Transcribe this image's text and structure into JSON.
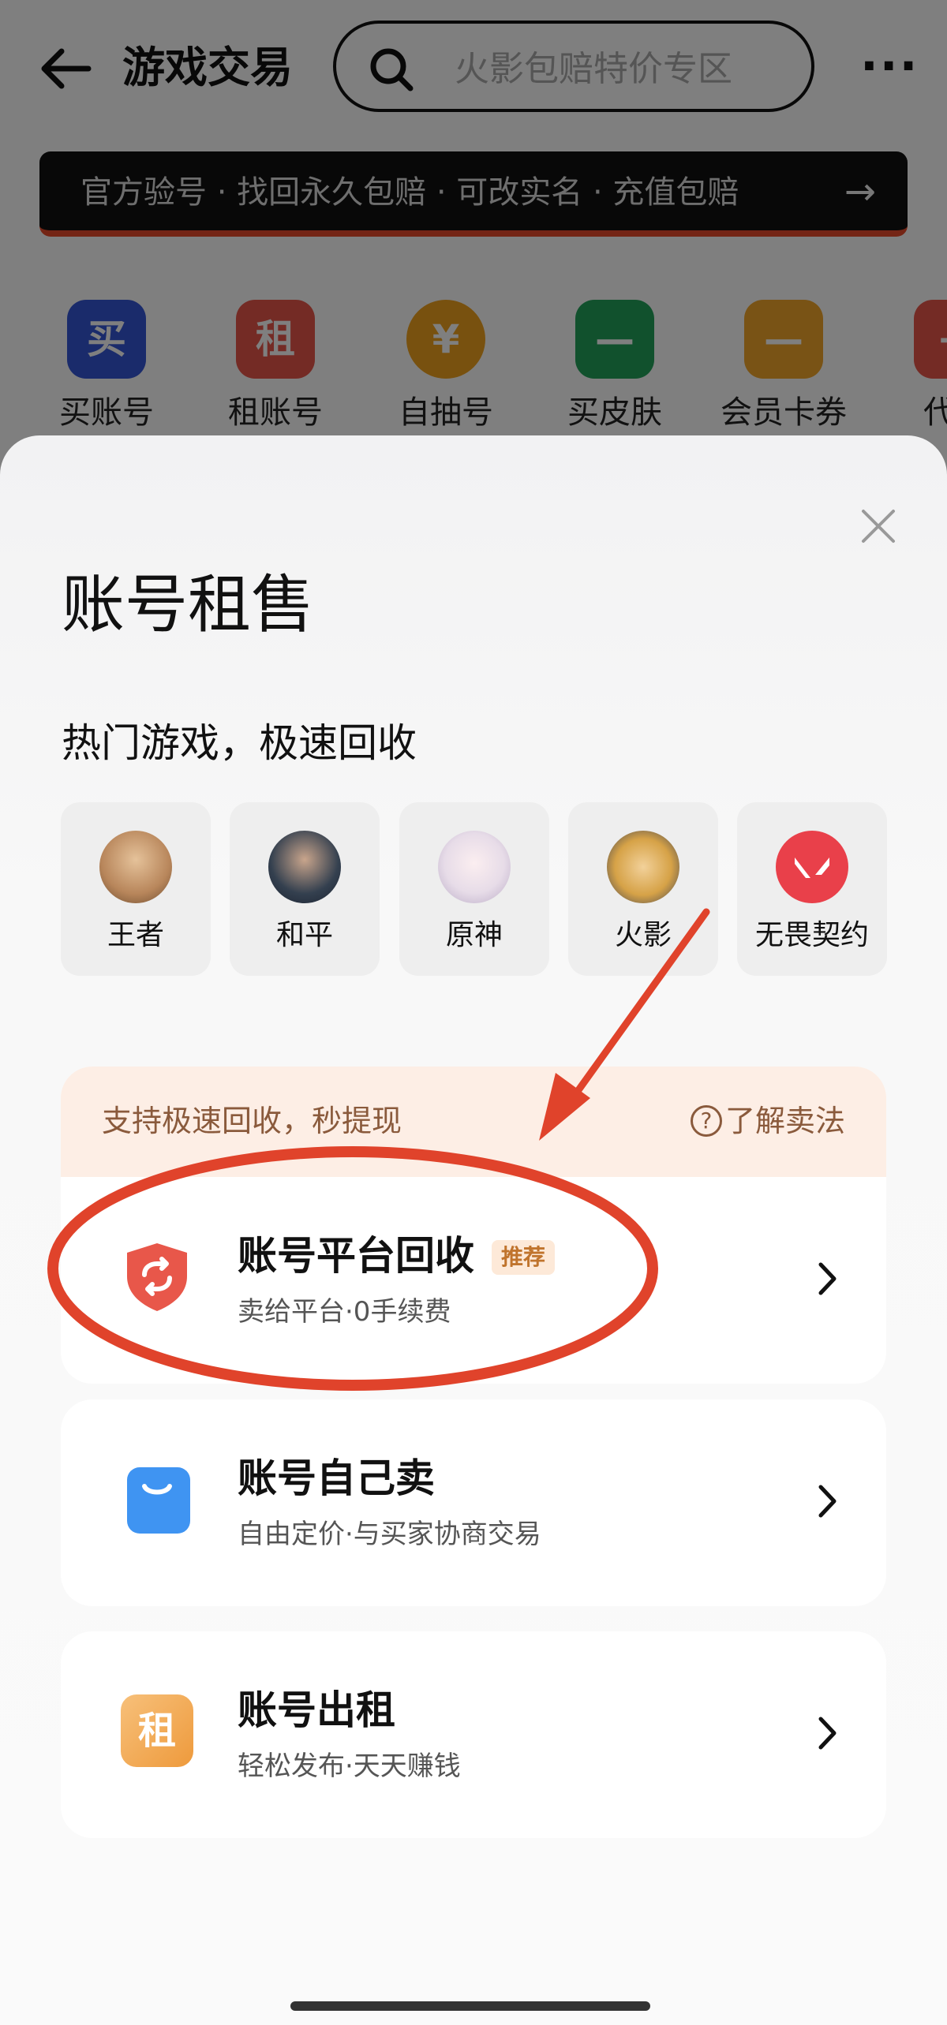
{
  "header": {
    "title": "游戏交易",
    "search_placeholder": "火影包赔特价专区",
    "more_label": "···"
  },
  "banner": {
    "text": "官方验号 · 找回永久包赔 · 可改实名 · 充值包赔",
    "arrow": "→"
  },
  "categories": [
    {
      "label": "买账号",
      "glyph": "买",
      "color": "#3557d6"
    },
    {
      "label": "租账号",
      "glyph": "租",
      "color": "#e8574a"
    },
    {
      "label": "自抽号",
      "glyph": "¥",
      "color": "#f1a21e"
    },
    {
      "label": "买皮肤",
      "glyph": "—",
      "color": "#22a25a"
    },
    {
      "label": "会员卡券",
      "glyph": "—",
      "color": "#f2a62a"
    },
    {
      "label": "代",
      "glyph": "+",
      "color": "#e8574a"
    }
  ],
  "sheet": {
    "title": "账号租售",
    "subtitle": "热门游戏，极速回收",
    "games": [
      {
        "label": "王者",
        "color": "#b8865b"
      },
      {
        "label": "和平",
        "color": "#34404f"
      },
      {
        "label": "原神",
        "color": "#e7dce8"
      },
      {
        "label": "火影",
        "color": "#d6a247"
      },
      {
        "label": "无畏契约",
        "color": "#e9404a"
      }
    ],
    "promo_text": "支持极速回收，秒提现",
    "promo_link_icon": "?",
    "promo_link": "了解卖法",
    "options": [
      {
        "title": "账号平台回收",
        "badge": "推荐",
        "desc": "卖给平台·0手续费",
        "icon": "shield-recycle-icon",
        "icon_color": "#e8574a"
      },
      {
        "title": "账号自己卖",
        "desc": "自由定价·与买家协商交易",
        "icon": "shopping-bag-icon",
        "icon_color": "#3f94f2"
      },
      {
        "title": "账号出租",
        "desc": "轻松发布·天天赚钱",
        "icon_glyph": "租",
        "icon": "rent-icon",
        "icon_color": "#f0a64a"
      }
    ]
  },
  "colors": {
    "annotation": "#e0432b",
    "accent": "#e84b2b"
  }
}
